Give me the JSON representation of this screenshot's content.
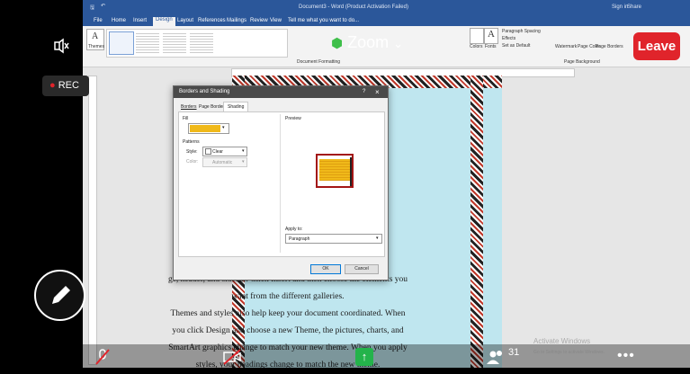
{
  "word": {
    "title": "Document3 - Word (Product Activation Failed)",
    "account": "Sign in",
    "share": "Share",
    "tabs": [
      "File",
      "Home",
      "Insert",
      "Design",
      "Layout",
      "References",
      "Mailings",
      "Review",
      "View"
    ],
    "active_tab": "Design",
    "tell_me": "Tell me what you want to do...",
    "ribbon": {
      "themes": "Themes",
      "colors": "Colors",
      "fonts": "Fonts",
      "paragraph_spacing": "Paragraph Spacing",
      "effects": "Effects",
      "set_default": "Set as Default",
      "watermark": "Watermark",
      "page_color": "Page Color",
      "page_borders": "Page Borders",
      "doc_formatting": "Document Formatting",
      "page_background": "Page Background"
    },
    "body_lines": [
      "ge, header, and sidebar. Click Insert and then choose the elements you",
      "want from the different galleries.",
      "Themes and styles also help keep your document coordinated. When",
      "you click Design and choose a new Theme, the pictures, charts, and",
      "SmartArt graphics change to match your new theme. When you apply",
      "styles, your headings change to match the new theme."
    ]
  },
  "dialog": {
    "title": "Borders and Shading",
    "help": "?",
    "close": "×",
    "tabs": [
      "Borders",
      "Page Border",
      "Shading"
    ],
    "active_tab": "Shading",
    "fill_label": "Fill",
    "fill_color": "#f0b91a",
    "patterns_label": "Patterns",
    "style_label": "Style:",
    "style_value": "Clear",
    "color_label": "Color:",
    "color_value": "Automatic",
    "preview_label": "Preview",
    "apply_to_label": "Apply to:",
    "apply_to_value": "Paragraph",
    "ok": "OK",
    "cancel": "Cancel"
  },
  "zoom": {
    "banner": "Zoom",
    "leave": "Leave",
    "rec": "REC",
    "participants": "31",
    "activate_title": "Activate Windows",
    "activate_sub": "Go to Settings to activate Windows."
  },
  "colors": {
    "accent": "#2b579a",
    "leave": "#e0242b",
    "share_green": "#24b34b",
    "shield_green": "#3fbf4a"
  }
}
